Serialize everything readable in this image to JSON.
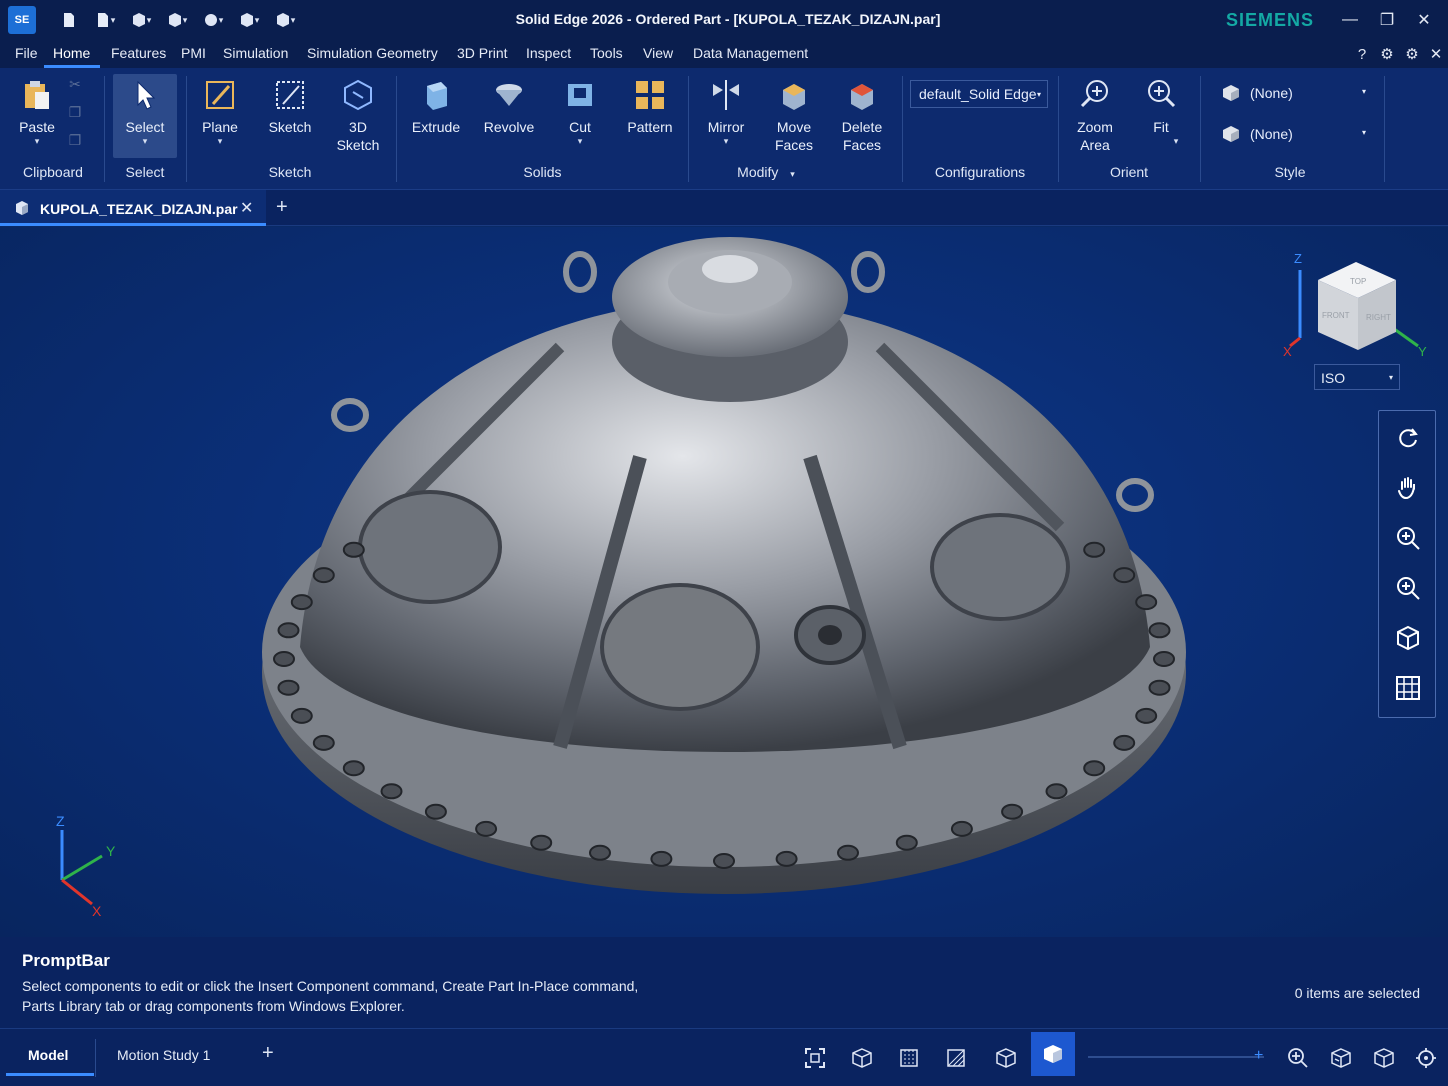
{
  "title_bar": {
    "app_logo": "SE",
    "title": "Solid Edge 2026 - Ordered Part - [KUPOLA_TEZAK_DIZAJN.par]",
    "brand": "SIEMENS",
    "quick_access_icons": [
      "document-icon",
      "new-icon",
      "part-icon",
      "sheetmetal-icon",
      "assembly-icon",
      "weldment-icon",
      "draft-icon"
    ]
  },
  "menu": {
    "items": [
      "File",
      "Home",
      "Features",
      "PMI",
      "Simulation",
      "Simulation Geometry",
      "3D Print",
      "Inspect",
      "Tools",
      "View",
      "Data Management"
    ],
    "active": "Home"
  },
  "ribbon": {
    "clipboard": {
      "paste": "Paste",
      "group": "Clipboard"
    },
    "select": {
      "select": "Select",
      "group": "Select"
    },
    "sketch": {
      "plane": "Plane",
      "sketch": "Sketch",
      "sketch3d_line1": "3D",
      "sketch3d_line2": "Sketch",
      "group": "Sketch"
    },
    "solids": {
      "extrude": "Extrude",
      "revolve": "Revolve",
      "cut": "Cut",
      "pattern": "Pattern",
      "group": "Solids"
    },
    "modify": {
      "mirror": "Mirror",
      "move_faces_line1": "Move",
      "move_faces_line2": "Faces",
      "delete_faces_line1": "Delete",
      "delete_faces_line2": "Faces",
      "group": "Modify"
    },
    "configurations": {
      "value": "default_Solid Edge",
      "group": "Configurations"
    },
    "orient": {
      "zoom_area_line1": "Zoom",
      "zoom_area_line2": "Area",
      "fit": "Fit",
      "group": "Orient"
    },
    "style": {
      "face_style": "(None)",
      "body_style": "(None)",
      "group": "Style"
    }
  },
  "document_tabs": [
    {
      "label": "KUPOLA_TEZAK_DIZAJN.par",
      "active": true
    }
  ],
  "viewport": {
    "view_cube": {
      "faces": [
        "TOP",
        "FRONT",
        "RIGHT"
      ],
      "axes": [
        "Z",
        "X",
        "Y"
      ],
      "view_mode": "ISO"
    },
    "triad_axes": [
      "Z",
      "Y",
      "X"
    ],
    "nav_tools": [
      "rotate-icon",
      "pan-icon",
      "zoom-in-icon",
      "zoom-icon",
      "view-orient-icon",
      "grid-icon"
    ]
  },
  "prompt_bar": {
    "title": "PromptBar",
    "message_line1": "Select components to edit or click the Insert Component command, Create Part In-Place command,",
    "message_line2": "Parts Library tab or drag components from Windows Explorer.",
    "selection_count": "0 items are selected"
  },
  "bottom_bar": {
    "tabs": [
      "Model",
      "Motion Study 1"
    ],
    "active_tab": "Model",
    "view_buttons": [
      "fit-view-icon",
      "wireframe-icon",
      "hidden-edges-icon",
      "section-icon",
      "visible-edges-icon",
      "shaded-icon"
    ],
    "zoom_icons": [
      "zoom-icon",
      "view-box-icon",
      "iso-view-icon",
      "orbit-icon"
    ]
  },
  "colors": {
    "accent": "#3b8cff",
    "brand": "#14a9a4",
    "background": "#0a2a66"
  }
}
